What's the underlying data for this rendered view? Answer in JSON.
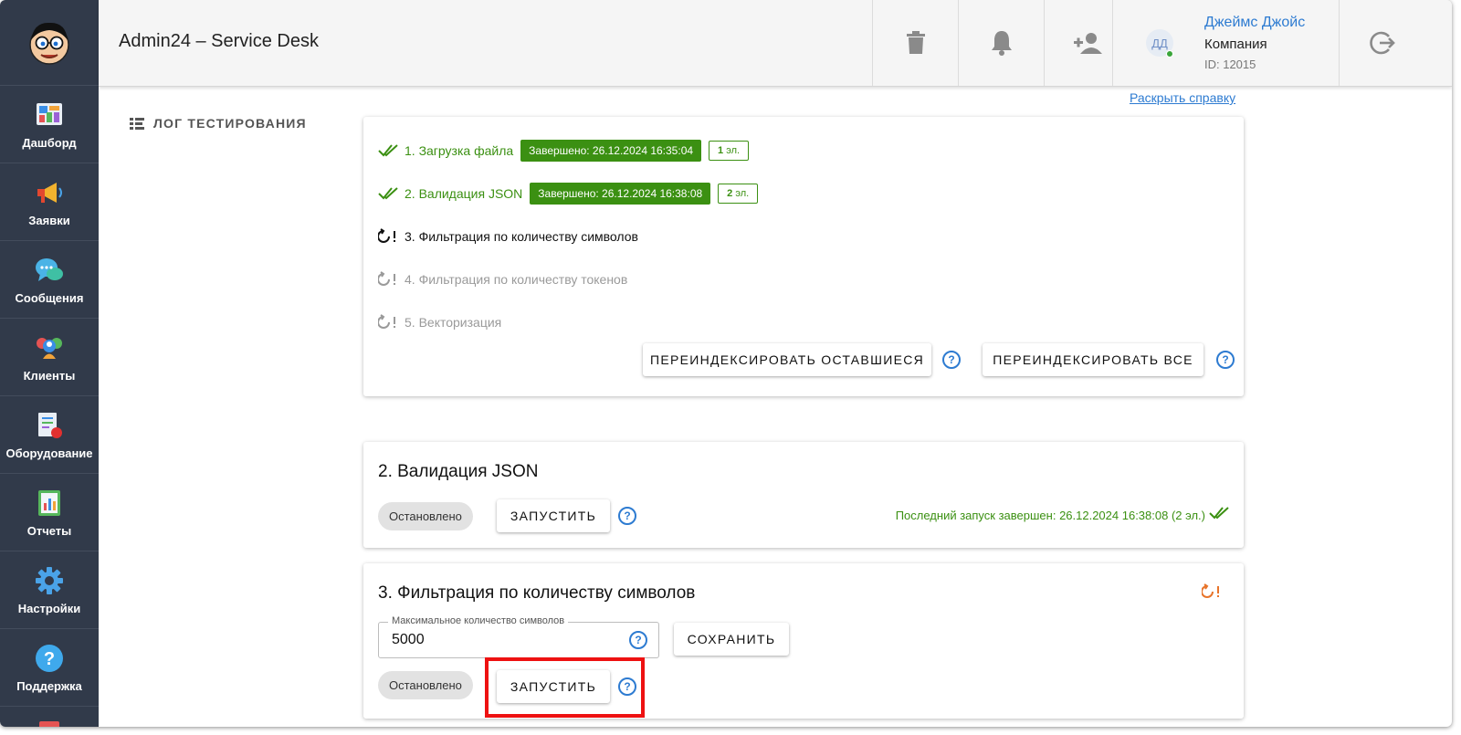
{
  "app": {
    "title": "Admin24 – Service Desk"
  },
  "sidebar": {
    "items": [
      {
        "label": "Дашборд",
        "icon": "dashboard-icon"
      },
      {
        "label": "Заявки",
        "icon": "megaphone-icon"
      },
      {
        "label": "Сообщения",
        "icon": "chat-icon"
      },
      {
        "label": "Клиенты",
        "icon": "clients-icon"
      },
      {
        "label": "Оборудование",
        "icon": "equipment-icon"
      },
      {
        "label": "Отчеты",
        "icon": "reports-icon"
      },
      {
        "label": "Настройки",
        "icon": "gear-icon"
      },
      {
        "label": "Поддержка",
        "icon": "support-icon"
      }
    ]
  },
  "header": {
    "user": {
      "initials": "ДД",
      "name": "Джеймс Джойс",
      "company": "Компания",
      "id": "ID: 12015"
    }
  },
  "help_link": "Раскрыть справку",
  "section_label": "ЛОГ ТЕСТИРОВАНИЯ",
  "log": {
    "steps": [
      {
        "label": "1. Загрузка файла",
        "status": "done",
        "badge": "Завершено: 26.12.2024 16:35:04",
        "count_num": "1",
        "count_unit": "эл."
      },
      {
        "label": "2. Валидация JSON",
        "status": "done",
        "badge": "Завершено: 26.12.2024 16:38:08",
        "count_num": "2",
        "count_unit": "эл."
      },
      {
        "label": "3. Фильтрация по количеству символов",
        "status": "pending"
      },
      {
        "label": "4. Фильтрация по количеству токенов",
        "status": "inactive"
      },
      {
        "label": "5. Векторизация",
        "status": "inactive"
      }
    ],
    "reindex_remaining": "ПЕРЕИНДЕКСИРОВАТЬ ОСТАВШИЕСЯ",
    "reindex_all": "ПЕРЕИНДЕКСИРОВАТЬ ВСЕ"
  },
  "validation_card": {
    "title": "2. Валидация JSON",
    "status_chip": "Остановлено",
    "run_button": "ЗАПУСТИТЬ",
    "last_run": "Последний запуск завершен: 26.12.2024 16:38:08 (2 эл.)"
  },
  "filter_card": {
    "title": "3. Фильтрация по количеству символов",
    "field_label": "Максимальное количество символов",
    "field_value": "5000",
    "save_button": "СОХРАНИТЬ",
    "status_chip": "Остановлено",
    "run_button": "ЗАПУСТИТЬ"
  },
  "colors": {
    "sidebar": "#313a4a",
    "success": "#3b9012",
    "link": "#2d7bd1",
    "warning": "#e8742a",
    "highlight": "#ee1111"
  }
}
